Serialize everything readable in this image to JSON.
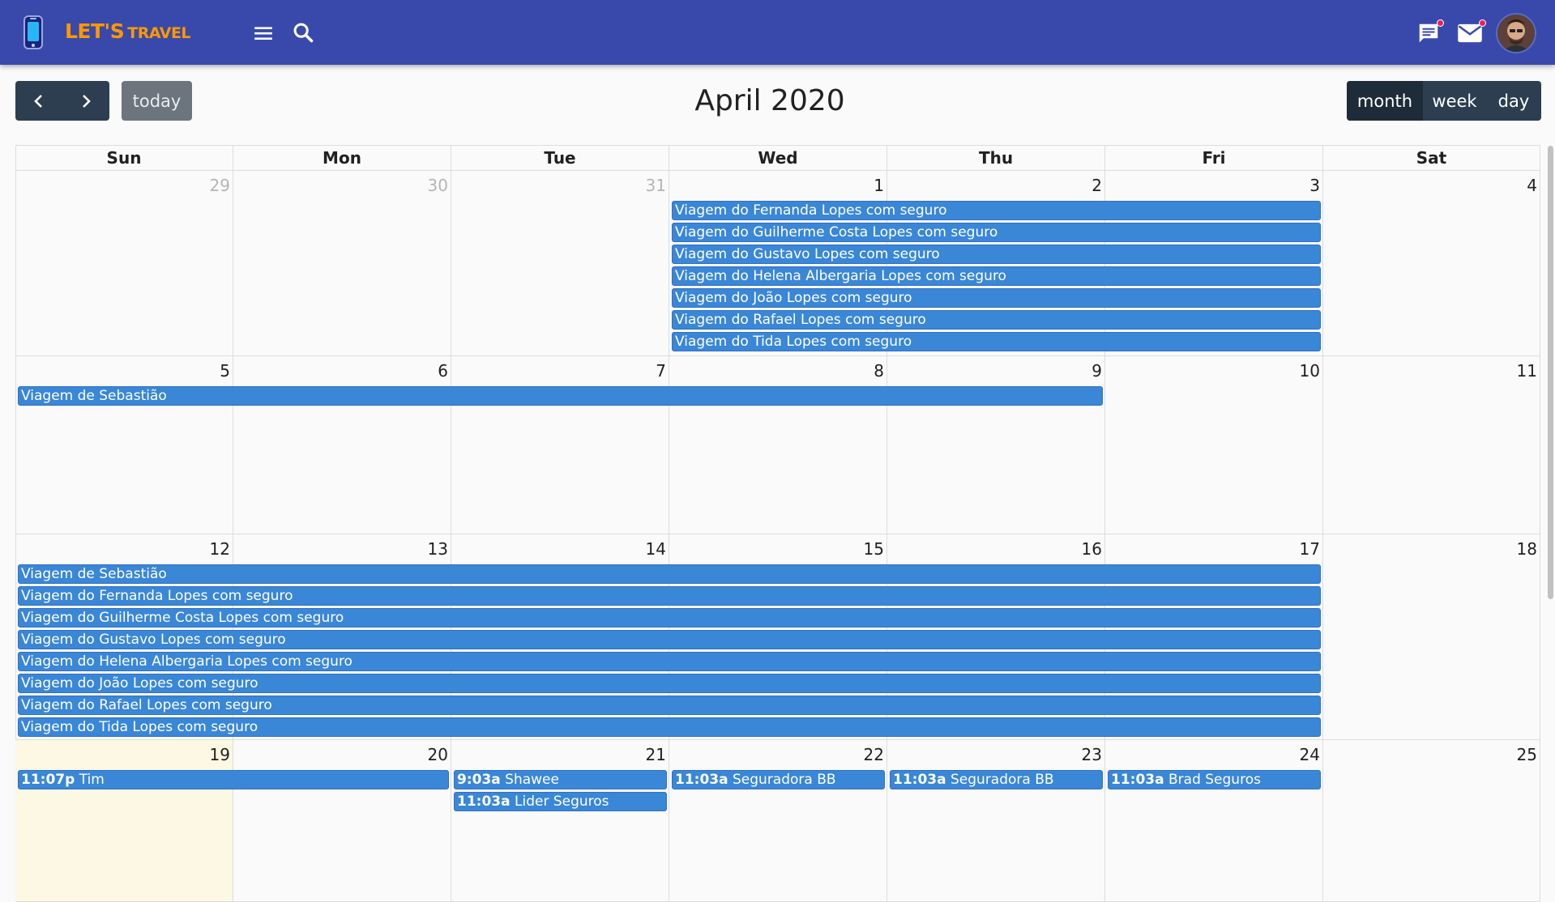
{
  "brand": {
    "main": "LET'S",
    "sub": "TRAVEL"
  },
  "icons": [
    "phone-app-icon",
    "menu-icon",
    "search-icon",
    "chat-icon",
    "mail-icon",
    "avatar"
  ],
  "toolbar": {
    "prev_icon": "‹",
    "next_icon": "›",
    "today_label": "today",
    "title": "April 2020",
    "views": [
      {
        "label": "month",
        "active": true
      },
      {
        "label": "week",
        "active": false
      },
      {
        "label": "day",
        "active": false
      }
    ]
  },
  "weekdays": [
    "Sun",
    "Mon",
    "Tue",
    "Wed",
    "Thu",
    "Fri",
    "Sat"
  ],
  "weeks": [
    {
      "days": [
        {
          "n": "29",
          "other": true
        },
        {
          "n": "30",
          "other": true
        },
        {
          "n": "31",
          "other": true
        },
        {
          "n": "1"
        },
        {
          "n": "2"
        },
        {
          "n": "3"
        },
        {
          "n": "4"
        }
      ]
    },
    {
      "days": [
        {
          "n": "5"
        },
        {
          "n": "6"
        },
        {
          "n": "7"
        },
        {
          "n": "8"
        },
        {
          "n": "9"
        },
        {
          "n": "10"
        },
        {
          "n": "11"
        }
      ]
    },
    {
      "days": [
        {
          "n": "12"
        },
        {
          "n": "13"
        },
        {
          "n": "14"
        },
        {
          "n": "15"
        },
        {
          "n": "16"
        },
        {
          "n": "17"
        },
        {
          "n": "18"
        }
      ]
    },
    {
      "days": [
        {
          "n": "19",
          "today": true
        },
        {
          "n": "20"
        },
        {
          "n": "21"
        },
        {
          "n": "22"
        },
        {
          "n": "23"
        },
        {
          "n": "24"
        },
        {
          "n": "25"
        }
      ]
    }
  ],
  "events": [
    {
      "week": 0,
      "start": 3,
      "end": 5,
      "row": 0,
      "title": "Viagem do Fernanda Lopes com seguro"
    },
    {
      "week": 0,
      "start": 3,
      "end": 5,
      "row": 1,
      "title": "Viagem do Guilherme Costa Lopes com seguro"
    },
    {
      "week": 0,
      "start": 3,
      "end": 5,
      "row": 2,
      "title": "Viagem do Gustavo Lopes com seguro"
    },
    {
      "week": 0,
      "start": 3,
      "end": 5,
      "row": 3,
      "title": "Viagem do Helena Albergaria Lopes com seguro"
    },
    {
      "week": 0,
      "start": 3,
      "end": 5,
      "row": 4,
      "title": "Viagem do João Lopes com seguro"
    },
    {
      "week": 0,
      "start": 3,
      "end": 5,
      "row": 5,
      "title": "Viagem do Rafael Lopes com seguro"
    },
    {
      "week": 0,
      "start": 3,
      "end": 5,
      "row": 6,
      "title": "Viagem do Tida Lopes com seguro"
    },
    {
      "week": 1,
      "start": 0,
      "end": 4,
      "row": 0,
      "title": "Viagem de Sebastião"
    },
    {
      "week": 2,
      "start": 0,
      "end": 5,
      "row": 0,
      "title": "Viagem de Sebastião"
    },
    {
      "week": 2,
      "start": 0,
      "end": 5,
      "row": 1,
      "title": "Viagem do Fernanda Lopes com seguro"
    },
    {
      "week": 2,
      "start": 0,
      "end": 5,
      "row": 2,
      "title": "Viagem do Guilherme Costa Lopes com seguro"
    },
    {
      "week": 2,
      "start": 0,
      "end": 5,
      "row": 3,
      "title": "Viagem do Gustavo Lopes com seguro"
    },
    {
      "week": 2,
      "start": 0,
      "end": 5,
      "row": 4,
      "title": "Viagem do Helena Albergaria Lopes com seguro"
    },
    {
      "week": 2,
      "start": 0,
      "end": 5,
      "row": 5,
      "title": "Viagem do João Lopes com seguro"
    },
    {
      "week": 2,
      "start": 0,
      "end": 5,
      "row": 6,
      "title": "Viagem do Rafael Lopes com seguro"
    },
    {
      "week": 2,
      "start": 0,
      "end": 5,
      "row": 7,
      "title": "Viagem do Tida Lopes com seguro"
    },
    {
      "week": 3,
      "start": 0,
      "end": 1,
      "row": 0,
      "time": "11:07p",
      "title": "Tim"
    },
    {
      "week": 3,
      "start": 2,
      "end": 2,
      "row": 0,
      "time": "9:03a",
      "title": "Shawee"
    },
    {
      "week": 3,
      "start": 2,
      "end": 2,
      "row": 1,
      "time": "11:03a",
      "title": "Lider Seguros"
    },
    {
      "week": 3,
      "start": 3,
      "end": 3,
      "row": 0,
      "time": "11:03a",
      "title": "Seguradora BB"
    },
    {
      "week": 3,
      "start": 4,
      "end": 4,
      "row": 0,
      "time": "11:03a",
      "title": "Seguradora BB"
    },
    {
      "week": 3,
      "start": 5,
      "end": 5,
      "row": 0,
      "time": "11:03a",
      "title": "Brad Seguros"
    }
  ],
  "colors": {
    "topbar": "#3949ab",
    "brand": "#ff9800",
    "event": "#3a87d8",
    "today_cell": "#fcf8e3",
    "toolbar_btn": "#2c3e50"
  }
}
